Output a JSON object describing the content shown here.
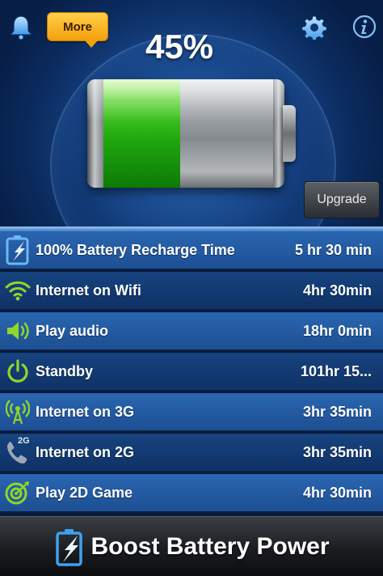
{
  "header": {
    "more_label": "More",
    "battery_percent_text": "45%",
    "battery_level": 0.45,
    "upgrade_label": "Upgrade"
  },
  "icons": {
    "bell": "bell-icon",
    "gear": "gear-icon",
    "info": "info-icon"
  },
  "list": {
    "items": [
      {
        "label": "100% Battery Recharge Time",
        "value": "5 hr 30 min",
        "icon": "battery-charge-icon"
      },
      {
        "label": "Internet on Wifi",
        "value": "4hr 30min",
        "icon": "wifi-icon"
      },
      {
        "label": "Play audio",
        "value": "18hr 0min",
        "icon": "speaker-icon"
      },
      {
        "label": "Standby",
        "value": "101hr 15...",
        "icon": "power-icon"
      },
      {
        "label": "Internet on 3G",
        "value": "3hr 35min",
        "icon": "antenna-icon"
      },
      {
        "label": "Internet on 2G",
        "value": "3hr 35min",
        "icon": "phone-2g-icon",
        "badge": "2G"
      },
      {
        "label": "Play 2D Game",
        "value": "4hr 30min",
        "icon": "target-icon"
      }
    ]
  },
  "footer": {
    "title": "Boost Battery Power"
  },
  "colors": {
    "accent_green": "#22b014",
    "row_blue_light": "#2a66b1",
    "row_blue_dark": "#17437f",
    "more_orange": "#f3a00b"
  }
}
